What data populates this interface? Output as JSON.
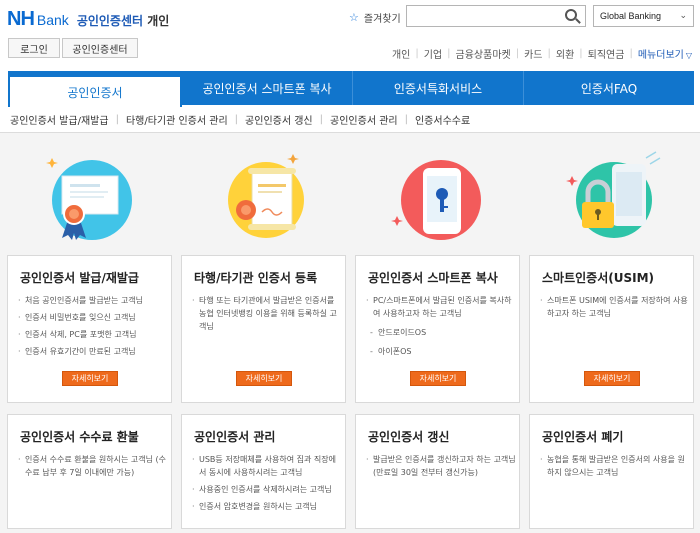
{
  "header": {
    "logo_nh": "NH",
    "logo_bank": "Bank",
    "site_title": "공인인증센터",
    "site_sub": "개인",
    "favorites_label": "즐겨찾기",
    "search_placeholder": "",
    "global_select": "Global Banking",
    "login_label": "로그인",
    "cert_center_label": "공인인증센터",
    "topnav": [
      "개인",
      "기업",
      "금융상품마켓",
      "카드",
      "외환",
      "퇴직연금"
    ],
    "menu_more": "메뉴더보기"
  },
  "tabs": [
    {
      "label": "공인인증서",
      "active": true
    },
    {
      "label": "공인인증서 스마트폰 복사",
      "active": false
    },
    {
      "label": "인증서특화서비스",
      "active": false
    },
    {
      "label": "인증서FAQ",
      "active": false
    }
  ],
  "subnav": [
    "공인인증서 발급/재발급",
    "타행/타기관 인증서 관리",
    "공인인증서 갱신",
    "공인인증서 관리",
    "인증서수수료"
  ],
  "cards": [
    {
      "title": "공인인증서 발급/재발급",
      "items": [
        "처음 공인인증서를 발급받는 고객님",
        "인증서 비밀번호를 잊으신 고객님",
        "인증서 삭제, PC를 포맷한 고객님",
        "인증서 유효기간이 만료된 고객님"
      ],
      "button": "자세히보기"
    },
    {
      "title": "타행/타기관 인증서 등록",
      "items": [
        "타행 또는 타기관에서 발급받은 인증서를 농협 인터넷뱅킹 이용을 위해 등록하실 고객님"
      ],
      "button": "자세히보기"
    },
    {
      "title": "공인인증서 스마트폰 복사",
      "items": [
        "PC/스마트폰에서 발급된 인증서를 복사하여 사용하고자 하는 고객님"
      ],
      "sub_items": [
        "안드로이드OS",
        "아이폰OS"
      ],
      "button": "자세히보기"
    },
    {
      "title": "스마트인증서(USIM)",
      "items": [
        "스마트폰 USIM에 인증서를 저장하여 사용하고자 하는 고객님"
      ],
      "button": "자세히보기"
    },
    {
      "title": "공인인증서 수수료 환불",
      "items": [
        "인증서 수수료 환불을 원하시는 고객님 (수수료 납부 후 7일 이내에만 가능)"
      ]
    },
    {
      "title": "공인인증서 관리",
      "items": [
        "USB등 저장매체를 사용하여 집과 직장에서 동시에 사용하시려는 고객님",
        "사용중인 인증서를 삭제하시려는 고객님",
        "인증서 암호변경을 원하시는 고객님"
      ]
    },
    {
      "title": "공인인증서 갱신",
      "items": [
        "발급받은 인증서를 갱신하고자 하는 고객님(만료일 30일 전부터 갱신가능)"
      ]
    },
    {
      "title": "공인인증서 폐기",
      "items": [
        "농협을 통해 발급받은 인증서의 사용을 원하지 않으시는 고객님"
      ]
    }
  ],
  "colors": {
    "brand_blue": "#1175cc",
    "accent_orange": "#ee6a1c",
    "illus_cyan": "#41c4e8",
    "illus_yellow": "#ffd23a",
    "illus_red": "#f35b5b",
    "illus_green": "#2ec4a8"
  },
  "icons": [
    "star-icon",
    "search-icon",
    "chevron-down-icon",
    "certificate-illustration",
    "document-seal-illustration",
    "smartphone-key-illustration",
    "usim-lock-illustration"
  ]
}
